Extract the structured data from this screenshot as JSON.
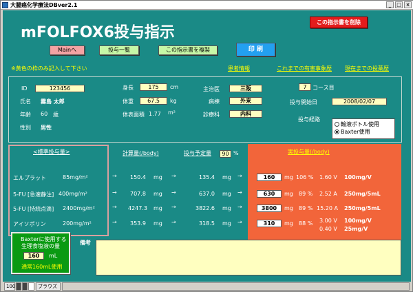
{
  "window": {
    "title": "大腸癌化学療法DBver2.1",
    "controls": [
      "_",
      "□",
      "×"
    ]
  },
  "header": {
    "title": "mFOLFOX6投与指示",
    "delete_button": "この指示書を削除",
    "main_button": "Mainへ",
    "list_button": "投与一覧",
    "copy_button": "この指示書を複製",
    "print_button": "印 刷",
    "note": "※黄色の枠のみ記入して下さい",
    "links": [
      "患者情報",
      "これまでの有害事象歴",
      "現在までの投薬歴"
    ]
  },
  "patient": {
    "id_label": "ID",
    "id": "123456",
    "name_label": "氏名",
    "name": "霧島 太郎",
    "age_label": "年齢",
    "age": "60",
    "age_unit": "歳",
    "sex_label": "性別",
    "sex": "男性",
    "height_label": "身長",
    "height": "175",
    "height_unit": "cm",
    "weight_label": "体重",
    "weight": "67.5",
    "weight_unit": "kg",
    "bsa_label": "体表面積",
    "bsa": "1.77",
    "bsa_unit": "m²",
    "doctor_label": "主治医",
    "doctor": "三阪",
    "ward_label": "病棟",
    "ward": "外来",
    "dept_label": "診療科",
    "dept": "内科",
    "course": "7",
    "course_label": "コース目",
    "start_label": "投与開始日",
    "start_date": "2008/02/07",
    "route_label": "投与経路",
    "route_options": [
      "輸液ボトル使用",
      "Baxter使用"
    ]
  },
  "dosing": {
    "std_header": "<標準投与量>",
    "calc_header": "計算量(/body)",
    "plan_header": "投与予定量",
    "plan_percent": "90",
    "percent_sign": "%",
    "actual_header": "実投与量(/body)",
    "rows": [
      {
        "drug": "エルプラット",
        "std": "85mg/m²",
        "calc": "150.4",
        "plan": "135.4",
        "actual": "160",
        "pct": "106 %",
        "vol": "1.60 V",
        "note": "100mg/V"
      },
      {
        "drug": "5-FU [急速静注]",
        "std": "400mg/m²",
        "calc": "707.8",
        "plan": "637.0",
        "actual": "630",
        "pct": "89 %",
        "vol": "2.52 A",
        "note": "250mg/5mL"
      },
      {
        "drug": "5-FU [持続点滴]",
        "std": "2400mg/m²",
        "calc": "4247.3",
        "plan": "3822.6",
        "actual": "3800",
        "pct": "89 %",
        "vol": "15.20 A",
        "note": "250mg/5mL"
      },
      {
        "drug": "アイソボリン",
        "std": "200mg/m²",
        "calc": "353.9",
        "plan": "318.5",
        "actual": "310",
        "pct": "88 %",
        "vol": "3.00 V",
        "vol2": "0.40 V",
        "note": "100mg/V",
        "note2": "25mg/V"
      }
    ],
    "unit_mg": "mg",
    "arrow": "→"
  },
  "baxter": {
    "line1": "Baxterに使用する",
    "line2": "生理食塩液の量",
    "value": "160",
    "unit": "mL",
    "note": "通常160mL使用"
  },
  "remarks": {
    "label": "備考",
    "value": ""
  },
  "statusbar": {
    "zoom": "100",
    "view": "ブラウズ"
  }
}
